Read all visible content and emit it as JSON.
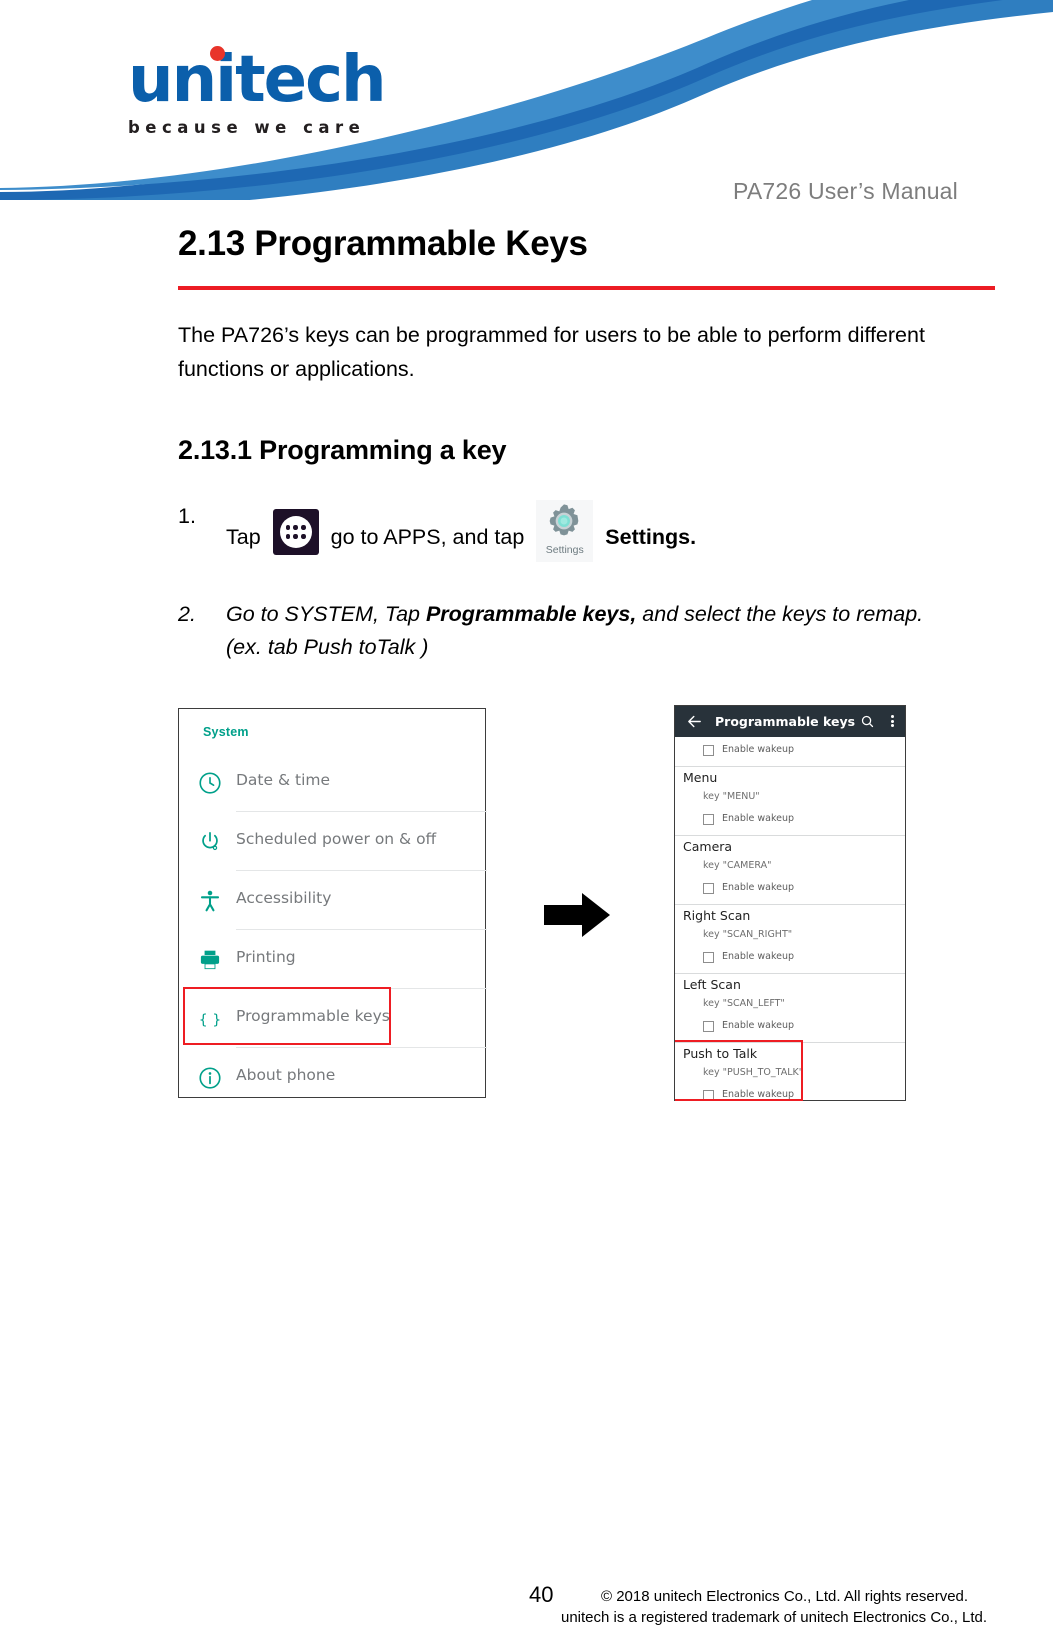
{
  "header": {
    "logo_text": "unitech",
    "logo_tagline": "because we care",
    "manual_title": "PA726 User’s Manual",
    "brand_blue": "#0b5fab",
    "brand_red": "#e8342a"
  },
  "section": {
    "heading": "2.13 Programmable Keys",
    "rule_color": "#ec1c24",
    "intro": "The PA726’s keys can be programmed for users to be able to perform different functions or applications.",
    "subheading": "2.13.1 Programming a key"
  },
  "steps": [
    {
      "number": "1.",
      "text_before_apps": "Tap",
      "apps_icon_name": "apps-grid-icon",
      "text_middle": "go to APPS, and tap",
      "settings_icon_name": "settings-gear-icon",
      "settings_icon_label": "Settings",
      "text_bold_end": "Settings."
    },
    {
      "number": "2.",
      "text_a": "Go to SYSTEM, Tap ",
      "text_bold": "Programmable keys,",
      "text_b": " and select the keys to remap.",
      "text_line2": "(ex. tab Push toTalk )"
    }
  ],
  "figure_left": {
    "section_label": "System",
    "accent_color": "#00a08a",
    "highlight_color": "#ee1d23",
    "items": [
      {
        "icon": "clock-icon",
        "label": "Date & time",
        "highlighted": false
      },
      {
        "icon": "power-icon",
        "label": "Scheduled power on & off",
        "highlighted": false
      },
      {
        "icon": "accessibility-icon",
        "label": "Accessibility",
        "highlighted": false
      },
      {
        "icon": "printer-icon",
        "label": "Printing",
        "highlighted": false
      },
      {
        "icon": "braces-icon",
        "label": "Programmable keys",
        "highlighted": true
      },
      {
        "icon": "info-icon",
        "label": "About phone",
        "highlighted": false
      }
    ]
  },
  "arrow": {
    "name": "right-arrow",
    "color": "#000000"
  },
  "figure_right": {
    "appbar": {
      "back_icon": "back-arrow-icon",
      "title": "Programmable keys",
      "search_icon": "search-icon",
      "overflow_icon": "overflow-menu-icon"
    },
    "checkbox_label": "Enable wakeup",
    "highlight_color": "#ee1d23",
    "entries": [
      {
        "section": "",
        "key": "",
        "checkbox": "Enable wakeup",
        "highlighted": false
      },
      {
        "section": "Menu",
        "key": "key \"MENU\"",
        "checkbox": "Enable wakeup",
        "highlighted": false
      },
      {
        "section": "Camera",
        "key": "key \"CAMERA\"",
        "checkbox": "Enable wakeup",
        "highlighted": false
      },
      {
        "section": "Right Scan",
        "key": "key \"SCAN_RIGHT\"",
        "checkbox": "Enable wakeup",
        "highlighted": false
      },
      {
        "section": "Left Scan",
        "key": "key \"SCAN_LEFT\"",
        "checkbox": "Enable wakeup",
        "highlighted": false
      },
      {
        "section": "Push to Talk",
        "key": "key \"PUSH_TO_TALK\"",
        "checkbox": "Enable wakeup",
        "highlighted": true
      }
    ]
  },
  "footer": {
    "page_number": "40",
    "copyright_line1": "© 2018 unitech Electronics Co., Ltd. All rights reserved.",
    "copyright_line2": "unitech is a registered trademark of unitech Electronics Co., Ltd."
  }
}
